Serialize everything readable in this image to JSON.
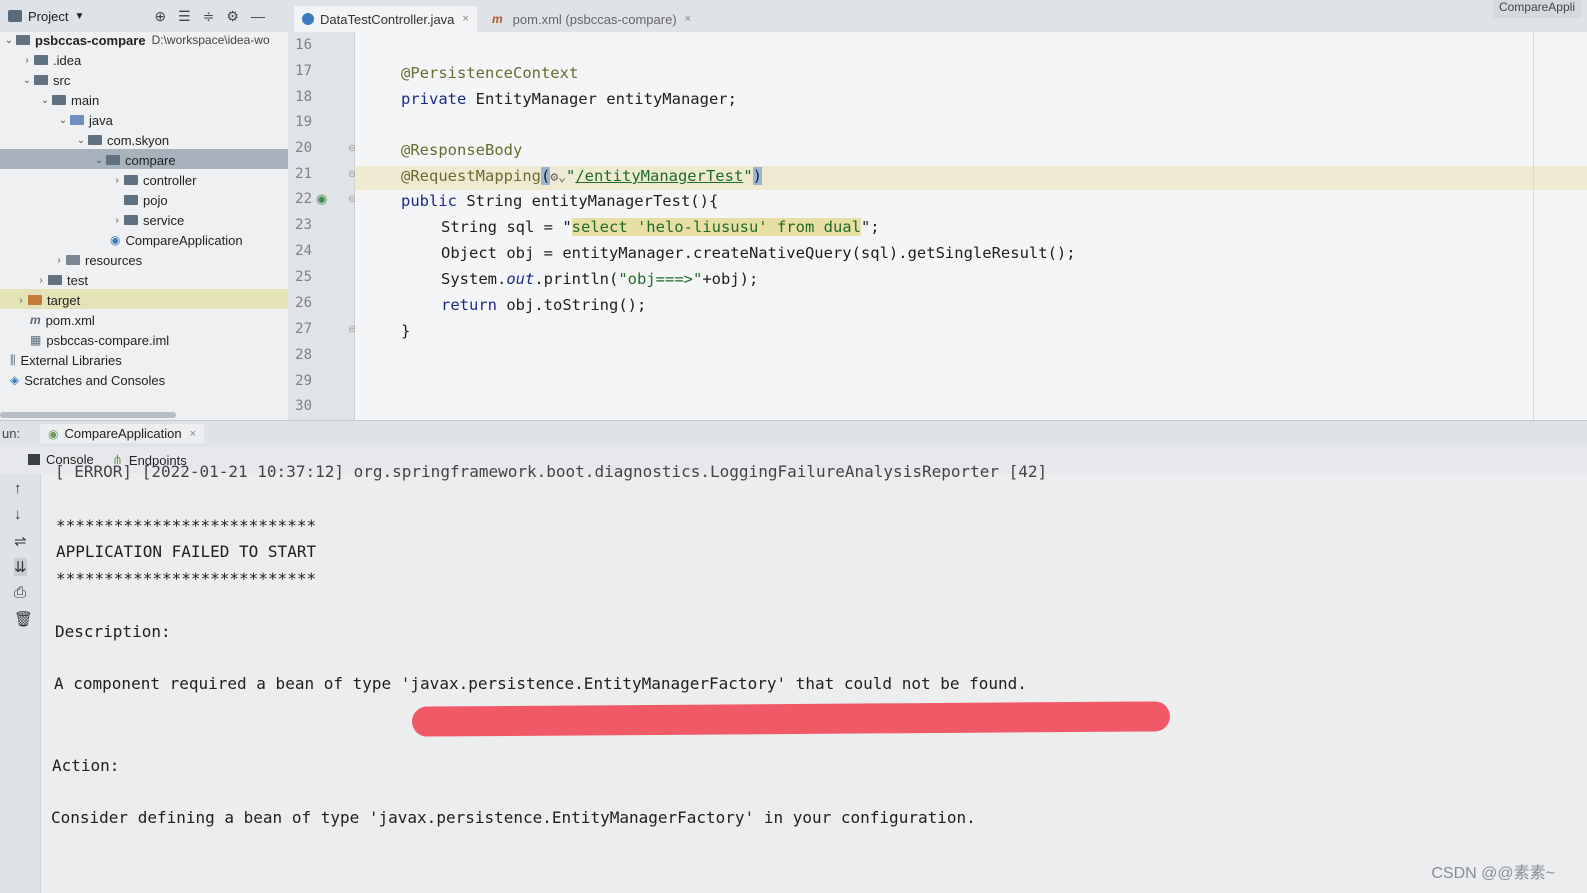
{
  "topbar": {
    "project_label": "Project",
    "tabs": [
      {
        "label": "DataTestController.java",
        "close": "×"
      },
      {
        "label": "pom.xml (psbccas-compare)",
        "close": "×"
      }
    ],
    "right_label": "CompareAppli"
  },
  "tree": {
    "root": {
      "name": "psbccas-compare",
      "path": "D:\\workspace\\idea-wo"
    },
    "items": [
      {
        "label": ".idea"
      },
      {
        "label": "src"
      },
      {
        "label": "main"
      },
      {
        "label": "java"
      },
      {
        "label": "com.skyon"
      },
      {
        "label": "compare"
      },
      {
        "label": "controller"
      },
      {
        "label": "pojo"
      },
      {
        "label": "service"
      },
      {
        "label": "CompareApplication"
      },
      {
        "label": "resources"
      },
      {
        "label": "test"
      },
      {
        "label": "target"
      },
      {
        "label": "pom.xml"
      },
      {
        "label": "psbccas-compare.iml"
      },
      {
        "label": "External Libraries"
      },
      {
        "label": "Scratches and Consoles"
      }
    ]
  },
  "editor": {
    "line_numbers": [
      "16",
      "17",
      "18",
      "19",
      "20",
      "21",
      "22",
      "23",
      "24",
      "25",
      "26",
      "27",
      "28",
      "29",
      "30"
    ],
    "lines": {
      "l17": "@PersistenceContext",
      "l18_kw": "private",
      "l18_rest": " EntityManager entityManager;",
      "l20": "@ResponseBody",
      "l21_ann": "@RequestMapping",
      "l21_open": "(",
      "l21_icon": "⚙⌄",
      "l21_q1": "\"",
      "l21_url": "/entityManagerTest",
      "l21_q2": "\"",
      "l21_close": ")",
      "l22_kw": "public",
      "l22_rest": " String entityManagerTest(){",
      "l23_pre": "String sql = \"",
      "l23_sql": "select 'helo-liususu' from dual",
      "l23_post": "\";",
      "l24": "Object obj = entityManager.createNativeQuery(sql).getSingleResult();",
      "l25_pre": "System.",
      "l25_it": "out",
      "l25_mid": ".println(",
      "l25_str": "\"obj===>\"",
      "l25_post": "+obj);",
      "l26_kw": "return",
      "l26_rest": " obj.toString();",
      "l27": "}"
    }
  },
  "run": {
    "label": "un:",
    "config": "CompareApplication",
    "close": "×",
    "tabs": [
      "Console",
      "Endpoints"
    ]
  },
  "console": {
    "cut_line": "[ ERROR] [2022-01-21 10:37:12] org.springframework.boot.diagnostics.LoggingFailureAnalysisReporter [42]",
    "stars1": "***************************",
    "failed": "APPLICATION FAILED TO START",
    "stars2": "***************************",
    "desc_label": "Description:",
    "desc_text": "A component required a bean of type 'javax.persistence.EntityManagerFactory' that could not be found.",
    "action_label": "Action:",
    "action_text": "Consider defining a bean of type 'javax.persistence.EntityManagerFactory' in your configuration."
  },
  "watermark": "CSDN @@素素~",
  "colors": {
    "annotation_stroke": "#f0525e",
    "tab_accent": "#4a88c7"
  }
}
